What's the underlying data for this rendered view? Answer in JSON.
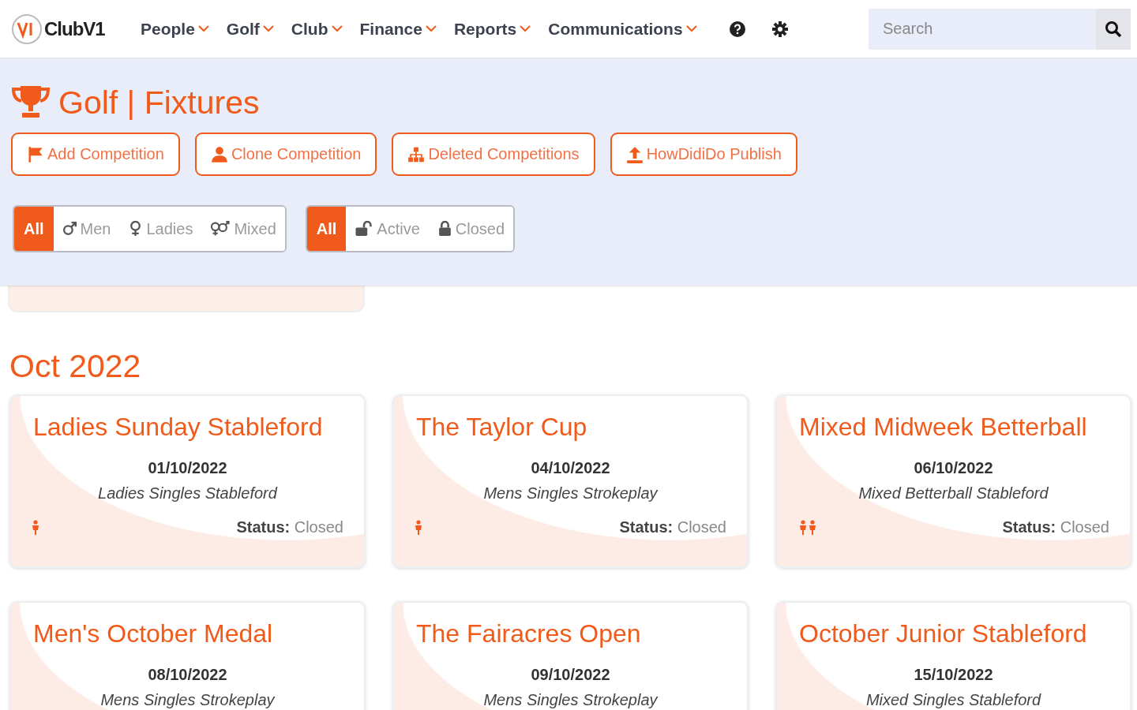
{
  "header": {
    "logo": "ClubV1",
    "nav": [
      {
        "label": "People"
      },
      {
        "label": "Golf"
      },
      {
        "label": "Club"
      },
      {
        "label": "Finance"
      },
      {
        "label": "Reports"
      },
      {
        "label": "Communications"
      }
    ],
    "search": {
      "placeholder": "Search"
    }
  },
  "page": {
    "title": "Golf | Fixtures",
    "actions": [
      {
        "label": "Add Competition",
        "kind": "flag"
      },
      {
        "label": "Clone Competition",
        "kind": "person"
      },
      {
        "label": "Deleted Competitions",
        "kind": "sitemap"
      },
      {
        "label": "HowDidiDo Publish",
        "kind": "upload"
      }
    ],
    "filter_groups": [
      [
        {
          "label": "All",
          "kind": "all",
          "selected": true
        },
        {
          "label": "Men",
          "kind": "male",
          "selected": false
        },
        {
          "label": "Ladies",
          "kind": "female",
          "selected": false
        },
        {
          "label": "Mixed",
          "kind": "mixed",
          "selected": false
        }
      ],
      [
        {
          "label": "All",
          "kind": "all",
          "selected": true
        },
        {
          "label": "Active",
          "kind": "unlock",
          "selected": false
        },
        {
          "label": "Closed",
          "kind": "lock",
          "selected": false
        }
      ]
    ]
  },
  "month": "Oct 2022",
  "cards": [
    {
      "title": "Ladies Sunday Stableford",
      "date": "01/10/2022",
      "format": "Ladies Singles Stableford",
      "kind": "single",
      "status_label": "Status:",
      "status": "Closed"
    },
    {
      "title": "The Taylor Cup",
      "date": "04/10/2022",
      "format": "Mens Singles Strokeplay",
      "kind": "single",
      "status_label": "Status:",
      "status": "Closed"
    },
    {
      "title": "Mixed Midweek Betterball",
      "date": "06/10/2022",
      "format": "Mixed Betterball Stableford",
      "kind": "pair",
      "status_label": "Status:",
      "status": "Closed"
    },
    {
      "title": "Men's October Medal",
      "date": "08/10/2022",
      "format": "Mens Singles Strokeplay"
    },
    {
      "title": "The Fairacres Open",
      "date": "09/10/2022",
      "format": "Mens Singles Strokeplay"
    },
    {
      "title": "October Junior Stableford",
      "date": "15/10/2022",
      "format": "Mixed Singles Stableford"
    }
  ]
}
